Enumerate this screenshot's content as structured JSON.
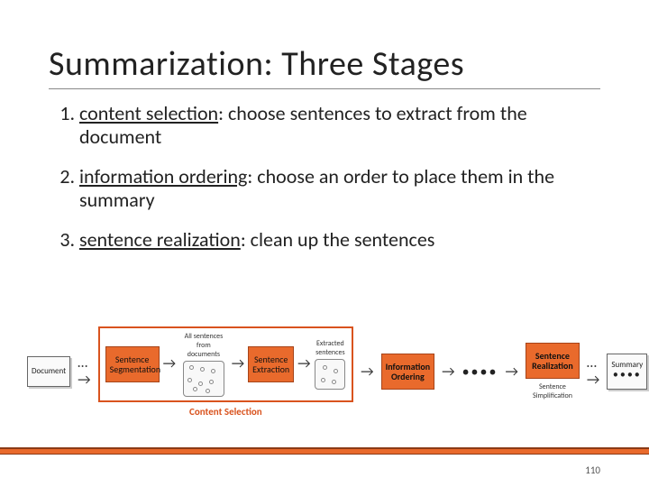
{
  "slide": {
    "title": "Summarization: Three Stages",
    "items": [
      {
        "term": "content selection",
        "rest": ": choose sentences to extract from the document"
      },
      {
        "term": "information ordering",
        "rest": ": choose an order to place them in the summary"
      },
      {
        "term": "sentence realization",
        "rest": ": clean up the sentences"
      }
    ],
    "page_number": "110"
  },
  "diagram": {
    "document": "Document",
    "cs_caption_all": "All sentences from documents",
    "cs_caption_ext": "Extracted sentences",
    "cs_box1": "Sentence Segmentation",
    "cs_box2": "Sentence Extraction",
    "cs_group_label": "Content Selection",
    "info_ordering": "Information Ordering",
    "sent_real": "Sentence Realization",
    "sent_simpl": "Sentence Simplification",
    "summary_label": "Summary",
    "dots": "••••"
  }
}
